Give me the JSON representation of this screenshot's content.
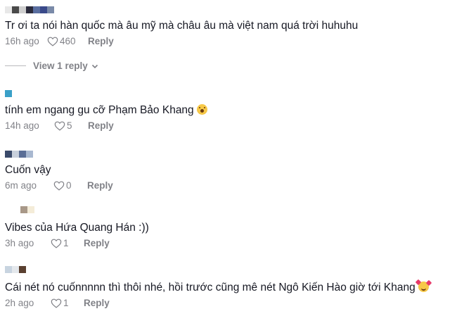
{
  "comments": [
    {
      "text": "Tr ơi ta nói hàn quốc mà âu mỹ mà châu âu mà việt nam quá trời huhuhu",
      "time": "16h ago",
      "likes": "460",
      "reply": "Reply",
      "emoji": "",
      "name_colors": [
        "#e8e8e8",
        "#4a4a4a",
        "#cfcfcf",
        "#2b2b3c",
        "#5a6ea0",
        "#3a4a8a",
        "#7a8aa8"
      ]
    },
    {
      "text": "tính em ngang gu cỡ Phạm Bảo Khang",
      "time": "14h ago",
      "likes": "5",
      "reply": "Reply",
      "emoji": "face-with-open-mouth",
      "name_colors": [
        "#3aa0c8"
      ]
    },
    {
      "text": "Cuốn vậy",
      "time": "6m ago",
      "likes": "0",
      "reply": "Reply",
      "emoji": "",
      "name_colors": [
        "#3a4a6a",
        "#c8d0dc",
        "#5a6e96",
        "#a8b8d0"
      ]
    },
    {
      "text": "Vibes của Hứa Quang Hán :))",
      "time": "3h ago",
      "likes": "1",
      "reply": "Reply",
      "emoji": "",
      "name_colors": [
        "#a89888",
        "#f4ecd8"
      ]
    },
    {
      "text": "Cái nét nó cuốnnnnn thì thôi nhé, hồi trước cũng mê nét Ngô Kiến Hào giờ tới Khang",
      "time": "2h ago",
      "likes": "1",
      "reply": "Reply",
      "emoji": "smiling-face-with-hearts",
      "name_colors": [
        "#c8d4e0",
        "#e4e8ec",
        "#5a4030"
      ]
    }
  ],
  "view_replies": {
    "label": "View 1 reply",
    "icon": "chevron-down-icon"
  },
  "colors": {
    "text": "#161823",
    "meta": "rgba(22,24,35,0.55)"
  }
}
